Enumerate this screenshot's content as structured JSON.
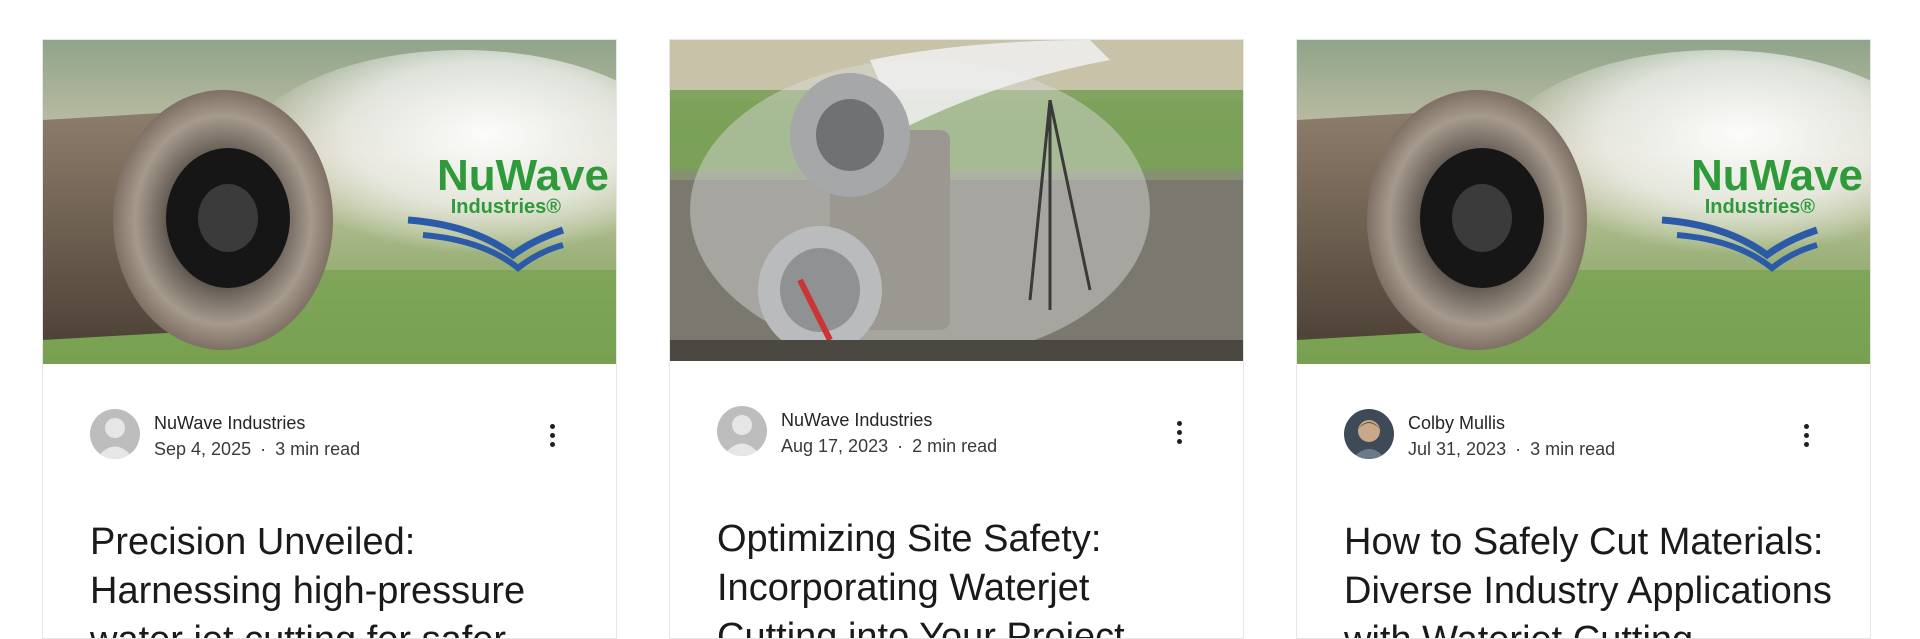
{
  "posts": [
    {
      "author": "NuWave Industries",
      "date": "Sep 4, 2025",
      "read_time": "3 min read",
      "title": "Precision Unveiled: Harnessing high-pressure water jet cutting for safer operations",
      "image_logo_text": "NuWave",
      "image_logo_sub": "Industries®",
      "avatar": "default-avatar-icon"
    },
    {
      "author": "NuWave Industries",
      "date": "Aug 17, 2023",
      "read_time": "2 min read",
      "title": "Optimizing Site Safety: Incorporating Waterjet Cutting into Your Project",
      "avatar": "default-avatar-icon"
    },
    {
      "author": "Colby Mullis",
      "date": "Jul 31, 2023",
      "read_time": "3 min read",
      "title": "How to Safely Cut Materials: Diverse Industry Applications with Waterjet Cutting",
      "image_logo_text": "NuWave",
      "image_logo_sub": "Industries®",
      "avatar": "user-photo-avatar"
    }
  ],
  "separator": "·",
  "colors": {
    "logo_green": "#2f9a3a",
    "logo_blue": "#2b5aa8",
    "text": "#1a1a1a"
  }
}
